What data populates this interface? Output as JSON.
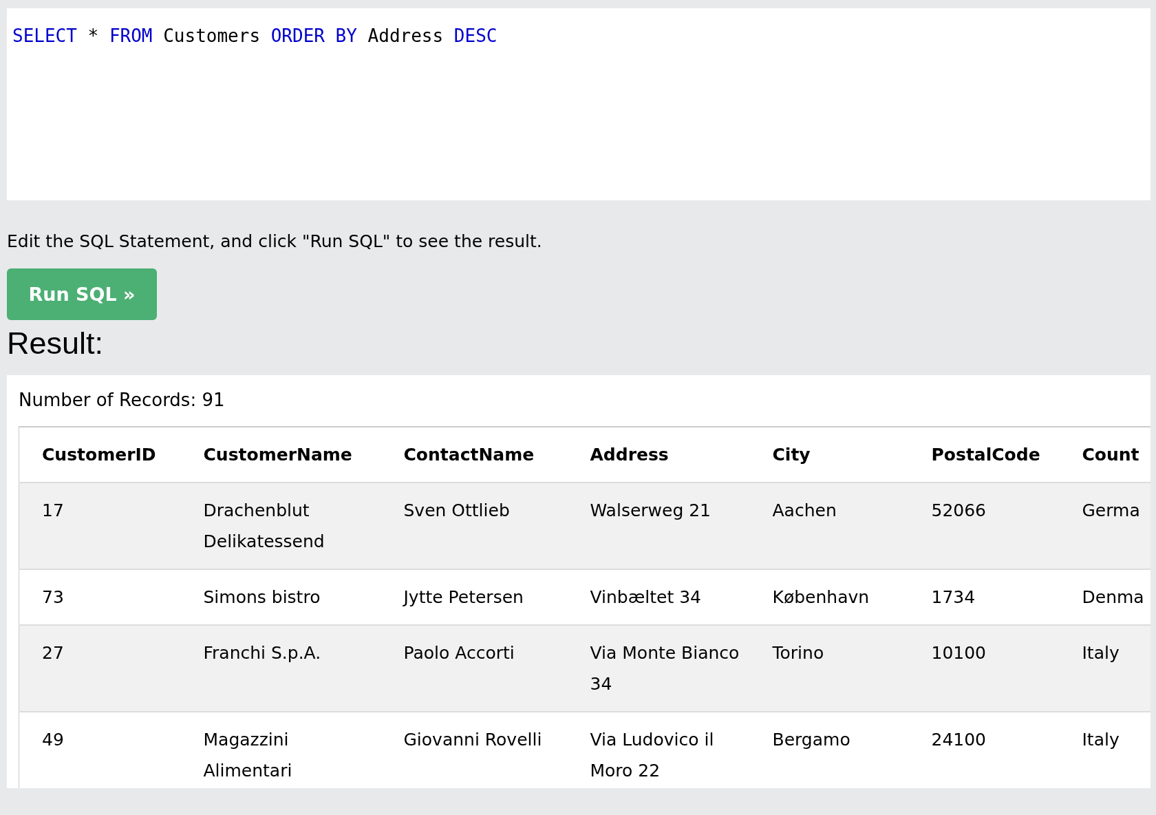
{
  "editor": {
    "code": [
      {
        "kind": "keyword",
        "text": "SELECT"
      },
      {
        "kind": "plain",
        "text": " * "
      },
      {
        "kind": "keyword",
        "text": "FROM"
      },
      {
        "kind": "plain",
        "text": " Customers "
      },
      {
        "kind": "keyword",
        "text": "ORDER BY"
      },
      {
        "kind": "plain",
        "text": " Address "
      },
      {
        "kind": "keyword",
        "text": "DESC"
      }
    ]
  },
  "instruction": "Edit the SQL Statement, and click \"Run SQL\" to see the result.",
  "run_button": "Run SQL »",
  "result_heading": "Result:",
  "record_count": "Number of Records: 91",
  "table": {
    "columns": [
      "CustomerID",
      "CustomerName",
      "ContactName",
      "Address",
      "City",
      "PostalCode",
      "Count"
    ],
    "rows": [
      [
        "17",
        "Drachenblut Delikatessend",
        "Sven Ottlieb",
        "Walserweg 21",
        "Aachen",
        "52066",
        "Germa"
      ],
      [
        "73",
        "Simons bistro",
        "Jytte Petersen",
        "Vinbæltet 34",
        "København",
        "1734",
        "Denma"
      ],
      [
        "27",
        "Franchi S.p.A.",
        "Paolo Accorti",
        "Via Monte Bianco 34",
        "Torino",
        "10100",
        "Italy"
      ],
      [
        "49",
        "Magazzini Alimentari",
        "Giovanni Rovelli",
        "Via Ludovico il Moro 22",
        "Bergamo",
        "24100",
        "Italy"
      ]
    ]
  }
}
